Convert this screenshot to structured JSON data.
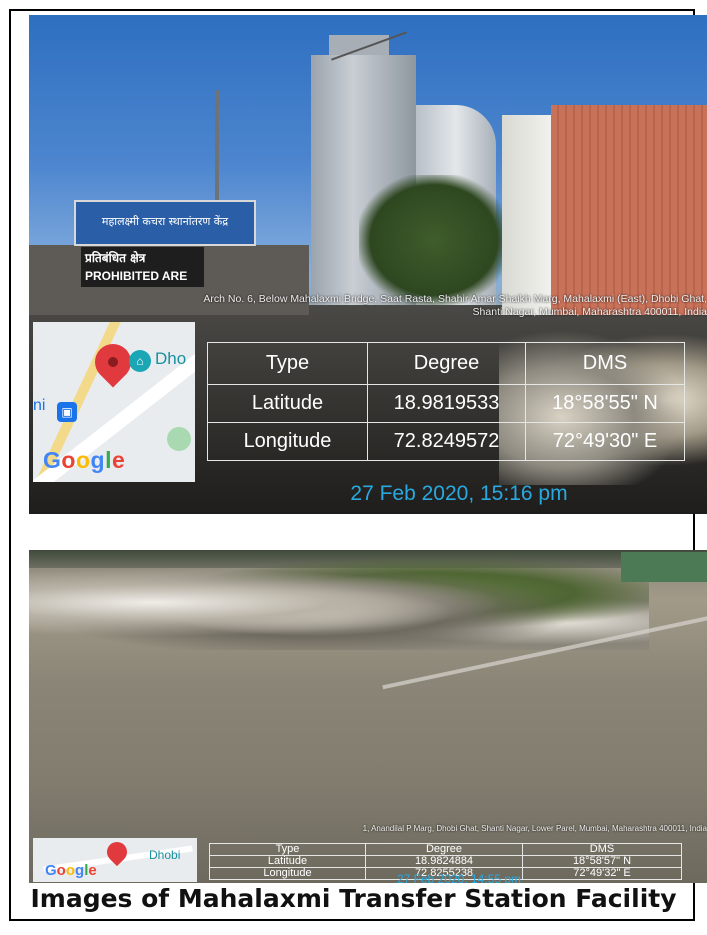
{
  "photo1": {
    "address": "Arch No. 6, Below Mahalaxmi Bridge, Saat Rasta, Shahir Amar Shaikh Marg, Mahalaxmi (East), Dhobi Ghat, Shanti Nagar, Mumbai, Maharashtra 400011, India",
    "sign_blue": "महालक्ष्मी कचरा स्थानांतरण केंद्र",
    "sign_prohibited_1": "प्रतिबंधित क्षेत्र",
    "sign_prohibited_2": "PROHIBITED ARE",
    "map": {
      "poi_label": "Dho",
      "left_label": "ni",
      "logo": "Google",
      "pin_icon": "map-pin-icon",
      "transit_icon": "bus-icon"
    },
    "table": {
      "headers": [
        "Type",
        "Degree",
        "DMS"
      ],
      "rows": [
        [
          "Latitude",
          "18.9819533",
          "18°58'55\" N"
        ],
        [
          "Longitude",
          "72.8249572",
          "72°49'30\" E"
        ]
      ]
    },
    "timestamp": "27 Feb 2020, 15:16 pm"
  },
  "photo2": {
    "address": "1, Anandilal P Marg, Dhobi Ghat, Shanti Nagar, Lower Parel, Mumbai, Maharashtra 400011, India",
    "map": {
      "poi_label": "Dhobi",
      "logo": "Google",
      "pin_icon": "map-pin-icon"
    },
    "table": {
      "headers": [
        "Type",
        "Degree",
        "DMS"
      ],
      "rows": [
        [
          "Latitude",
          "18.9824884",
          "18°58'57\" N"
        ],
        [
          "Longitude",
          "72.8255238",
          "72°49'32\" E"
        ]
      ]
    },
    "timestamp": "27 Feb 2020, 14:55 pm"
  },
  "caption": "Images of Mahalaxmi Transfer Station Facility",
  "colors": {
    "timestamp": "#29a9e0",
    "map_pin": "#e0393e"
  }
}
